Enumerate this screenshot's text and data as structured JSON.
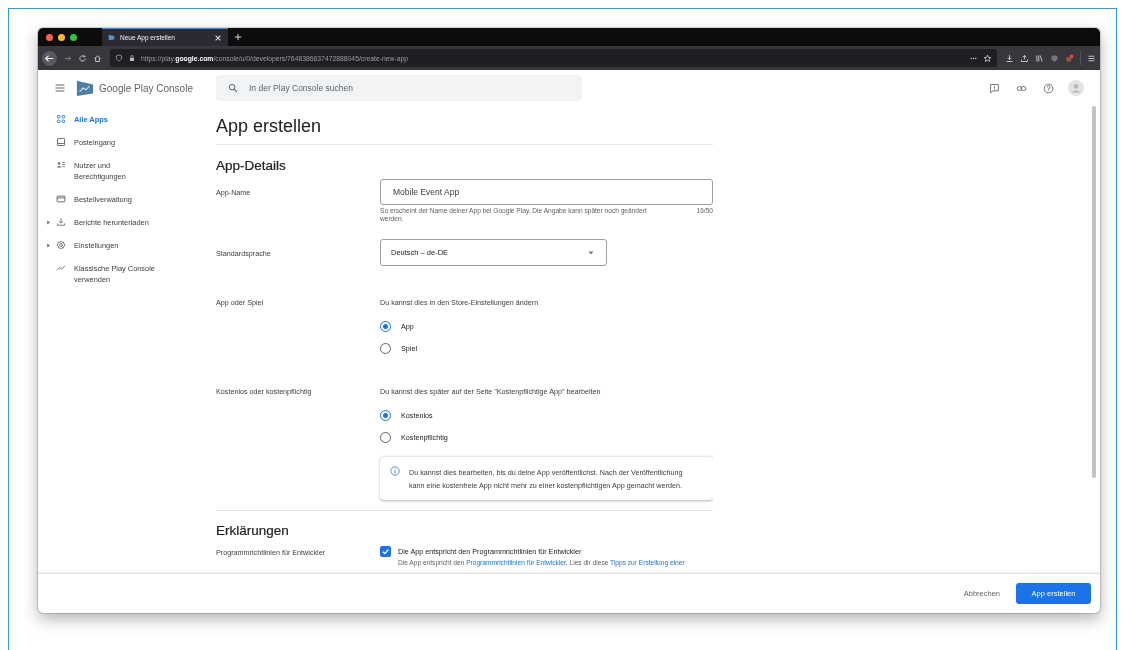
{
  "browser": {
    "tab_title": "Neue App erstellen",
    "url": "https://play.**google.com**/console/u/0/developers/7648386637472888045/create-new-app"
  },
  "sidebar": {
    "brand": "Google Play Console",
    "items": [
      {
        "label": "Alle Apps",
        "kind": "link",
        "selected": true
      },
      {
        "label": "Posteingang",
        "kind": "link",
        "selected": false
      },
      {
        "label": "Nutzer und Berechtigungen",
        "kind": "link",
        "selected": false
      },
      {
        "label": "Bestellverwaltung",
        "kind": "link",
        "selected": false
      },
      {
        "label": "Berichte herunterladen",
        "kind": "group",
        "expanded": false,
        "selected": false
      },
      {
        "label": "Einstellungen",
        "kind": "group",
        "expanded": false,
        "selected": false
      },
      {
        "label": "Klassische Play Console verwenden",
        "kind": "link",
        "selected": false
      }
    ]
  },
  "search": {
    "placeholder": "In der Play Console suchen"
  },
  "page_title": "App erstellen",
  "details": {
    "heading": "App-Details",
    "app_name": {
      "label": "App-Name",
      "value": "Mobile Event App",
      "hint": "So erscheint der Name deiner App bei Google Play. Die Angabe kann später noch geändert werden.",
      "counter": "16/50"
    },
    "language": {
      "label": "Standardsprache",
      "value": "Deutsch – de-DE"
    },
    "app_type": {
      "label": "App oder Spiel",
      "note": "Du kannst dies in den Store-Einstellungen ändern",
      "options": [
        {
          "label": "App",
          "selected": true
        },
        {
          "label": "Spiel",
          "selected": false
        }
      ]
    },
    "pricing": {
      "label": "Kostenlos oder kostenpflichtig",
      "note": "Du kannst dies später auf der Seite \"Kostenpflichtige App\" bearbeiten",
      "options": [
        {
          "label": "Kostenlos",
          "selected": true
        },
        {
          "label": "Kostenpflichtig",
          "selected": false
        }
      ],
      "info": "Du kannst dies bearbeiten, bis du deine App veröffentlichst. Nach der Veröffentlichung kann eine kostenfreie App nicht mehr zu einer kostenpflichtigen App gemacht werden."
    }
  },
  "declarations": {
    "heading": "Erklärungen",
    "policy": {
      "label": "Programmrichtlinien für Entwickler",
      "checkbox_label": "Die App entspricht den Programmrichtlinien für Entwickler",
      "checked": true,
      "description": [
        {
          "kind": "text",
          "text": "Die App entspricht den "
        },
        {
          "kind": "link",
          "text": "Programmrichtlinien für Entwickler"
        },
        {
          "kind": "text",
          "text": ". Lies dir diese "
        },
        {
          "kind": "link",
          "text": "Tipps zur Erstellung einer"
        }
      ]
    }
  },
  "footer": {
    "cancel": "Abbrechen",
    "submit": "App erstellen"
  }
}
